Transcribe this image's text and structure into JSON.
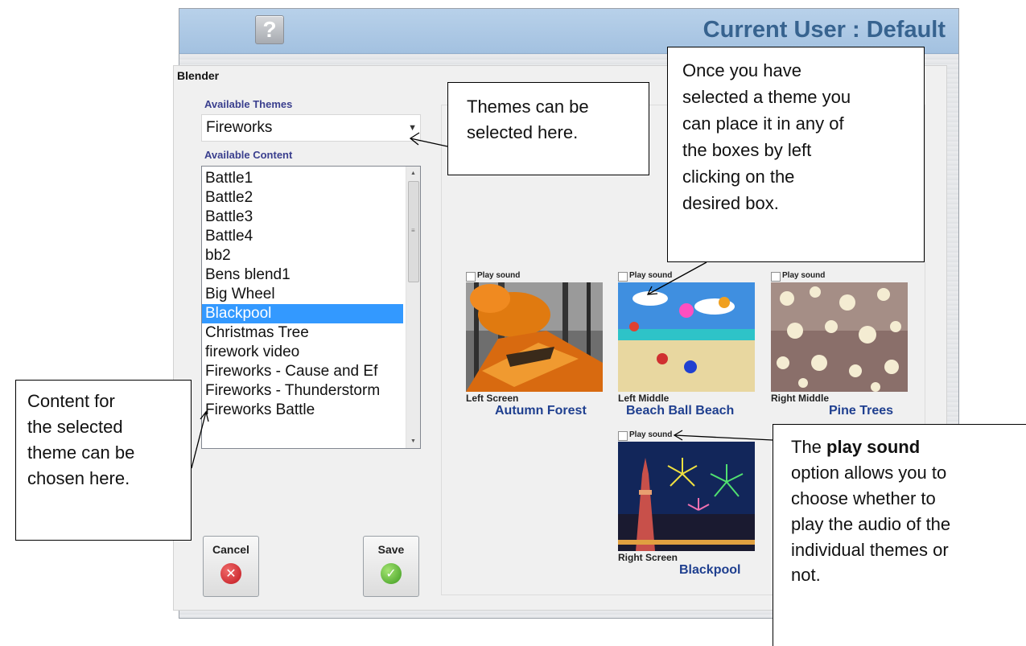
{
  "window": {
    "help_icon": "?",
    "title": "Current User : Default"
  },
  "blender": {
    "label": "Blender",
    "themes_label": "Available Themes",
    "selected_theme": "Fireworks",
    "content_label": "Available Content",
    "content_items": [
      "Battle1",
      "Battle2",
      "Battle3",
      "Battle4",
      "bb2",
      "Bens blend1",
      "Big Wheel",
      "Blackpool",
      "Christmas Tree",
      "firework video",
      "Fireworks - Cause and Ef",
      "Fireworks - Thunderstorm",
      "Fireworks Battle"
    ],
    "selected_content": "Blackpool"
  },
  "buttons": {
    "cancel": "Cancel",
    "save": "Save"
  },
  "screens": [
    {
      "play_label": "Play sound",
      "screen": "Left Screen",
      "theme": "Autumn Forest"
    },
    {
      "play_label": "Play sound",
      "screen": "Left Middle",
      "theme": "Beach Ball Beach"
    },
    {
      "play_label": "Play sound",
      "screen": "Right Middle",
      "theme": "Pine Trees"
    },
    {
      "play_label": "Play sound",
      "screen": "Right Screen",
      "theme": "Blackpool"
    }
  ],
  "callouts": {
    "themes": [
      "Themes can be",
      "selected here."
    ],
    "place": [
      "Once you have",
      "selected a theme you",
      "can place it in any of",
      "the boxes by left",
      "clicking on the",
      "desired box."
    ],
    "content": [
      "Content for",
      "the selected",
      "theme can be",
      "chosen here."
    ],
    "sound_bold": "play sound",
    "sound_prefix": "The ",
    "sound": [
      "option allows you to",
      "choose whether to",
      "play the audio of the",
      "individual themes or",
      "not."
    ]
  },
  "colors": {
    "title_text": "#37638f",
    "title_bar": "#a3c1e0",
    "selection": "#3399ff",
    "label_blue": "#3a3f8e",
    "theme_name": "#1f3f8f"
  },
  "icons": {
    "help": "question-mark-icon",
    "cancel": "red-x-circle-icon",
    "save": "green-check-circle-icon",
    "dropdown": "chevron-down-icon"
  }
}
